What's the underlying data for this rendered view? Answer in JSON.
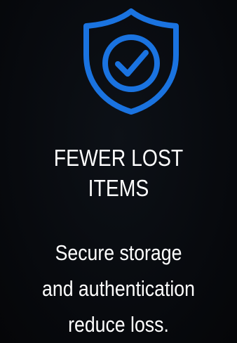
{
  "card": {
    "icon": "shield-check-icon",
    "accent_color": "#1a73e0",
    "title_lines": [
      "FEWER LOST",
      "ITEMS"
    ],
    "description_lines": [
      "Secure storage",
      "and authentication",
      "reduce loss."
    ]
  }
}
